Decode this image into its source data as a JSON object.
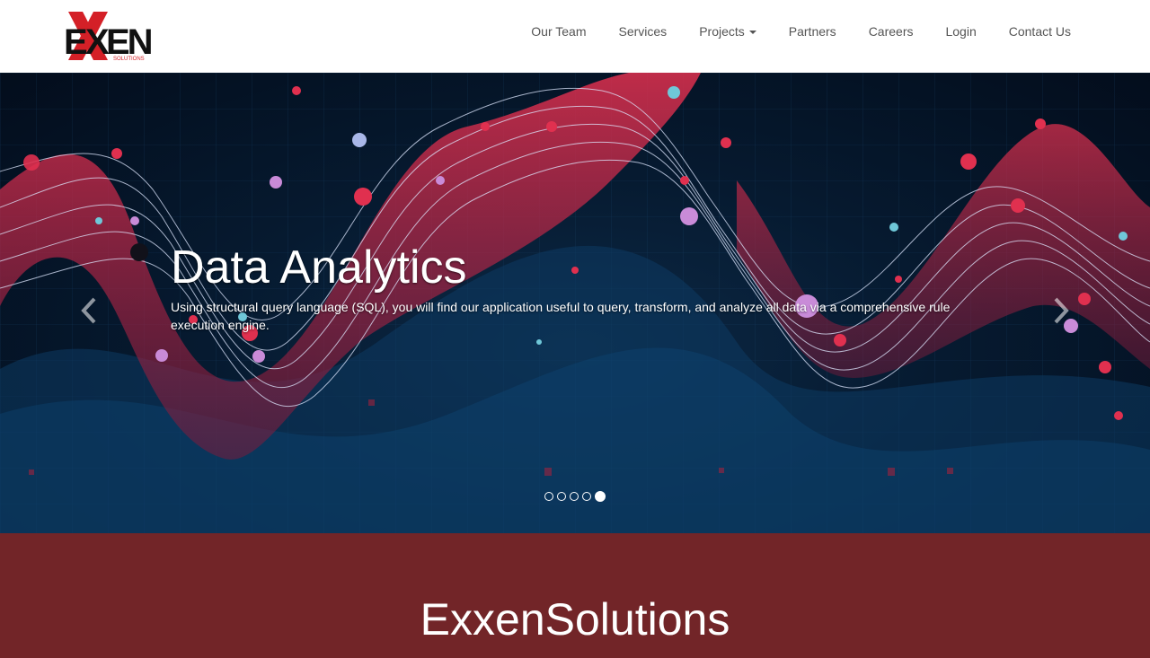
{
  "brand": {
    "logo_text": "EXXEN",
    "logo_subtext": "SOLUTIONS",
    "colors": {
      "red": "#d42027",
      "black": "#111111"
    }
  },
  "nav": {
    "items": [
      {
        "label": "Our Team"
      },
      {
        "label": "Services"
      },
      {
        "label": "Projects",
        "has_dropdown": true
      },
      {
        "label": "Partners"
      },
      {
        "label": "Careers"
      },
      {
        "label": "Login"
      },
      {
        "label": "Contact Us"
      }
    ],
    "dropdown_icon": "caret-down-icon"
  },
  "carousel": {
    "slide_title": "Data Analytics",
    "slide_text": "Using structural query language (SQL), you will find our application useful to query, transform, and analyze all data via a comprehensive rule execution engine.",
    "prev_icon": "chevron-left-icon",
    "next_icon": "chevron-right-icon",
    "slide_count": 5,
    "active_index": 4
  },
  "section": {
    "title": "ExxenSolutions",
    "background": "#722528"
  }
}
